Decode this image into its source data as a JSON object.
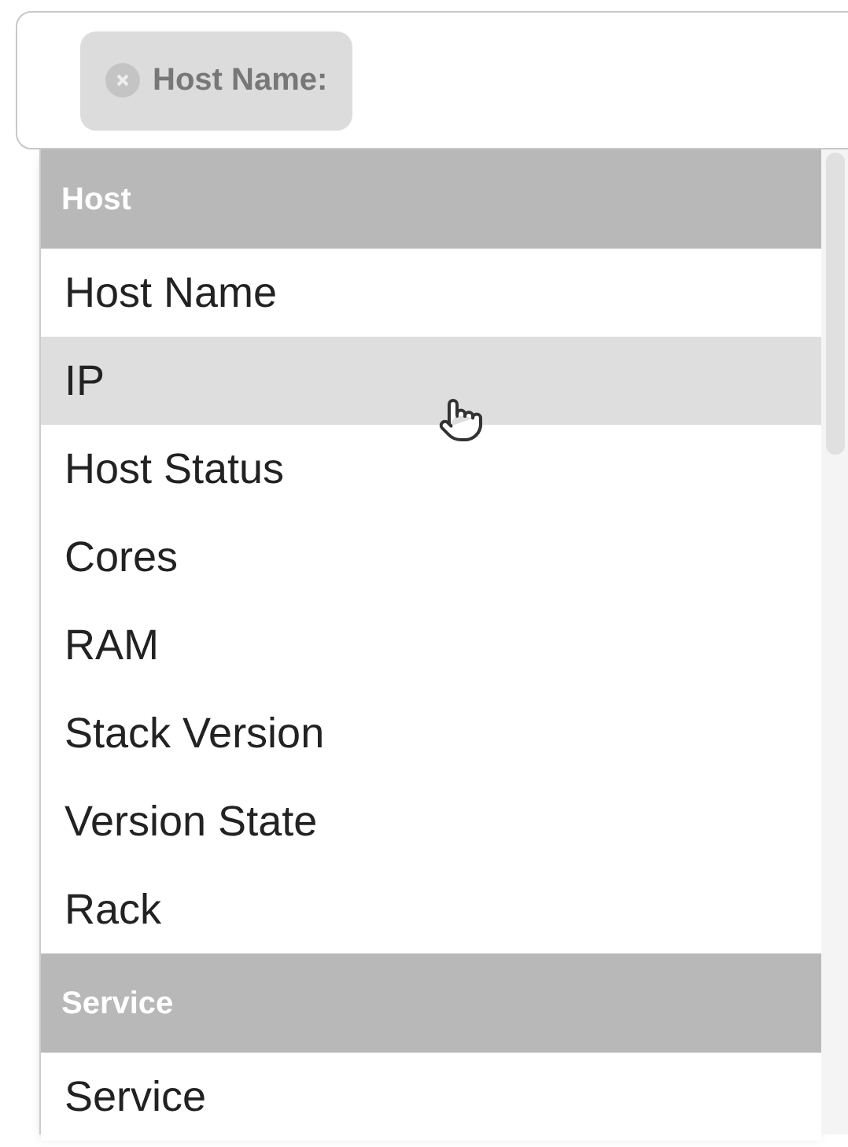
{
  "filter_field": {
    "chips": [
      {
        "label": "Host Name:"
      }
    ]
  },
  "dropdown": {
    "groups": [
      {
        "header": "Host",
        "items": [
          {
            "label": "Host Name",
            "hovered": false
          },
          {
            "label": "IP",
            "hovered": true
          },
          {
            "label": "Host Status",
            "hovered": false
          },
          {
            "label": "Cores",
            "hovered": false
          },
          {
            "label": "RAM",
            "hovered": false
          },
          {
            "label": "Stack Version",
            "hovered": false
          },
          {
            "label": "Version State",
            "hovered": false
          },
          {
            "label": "Rack",
            "hovered": false
          }
        ]
      },
      {
        "header": "Service",
        "items": [
          {
            "label": "Service",
            "hovered": false
          }
        ]
      }
    ]
  }
}
